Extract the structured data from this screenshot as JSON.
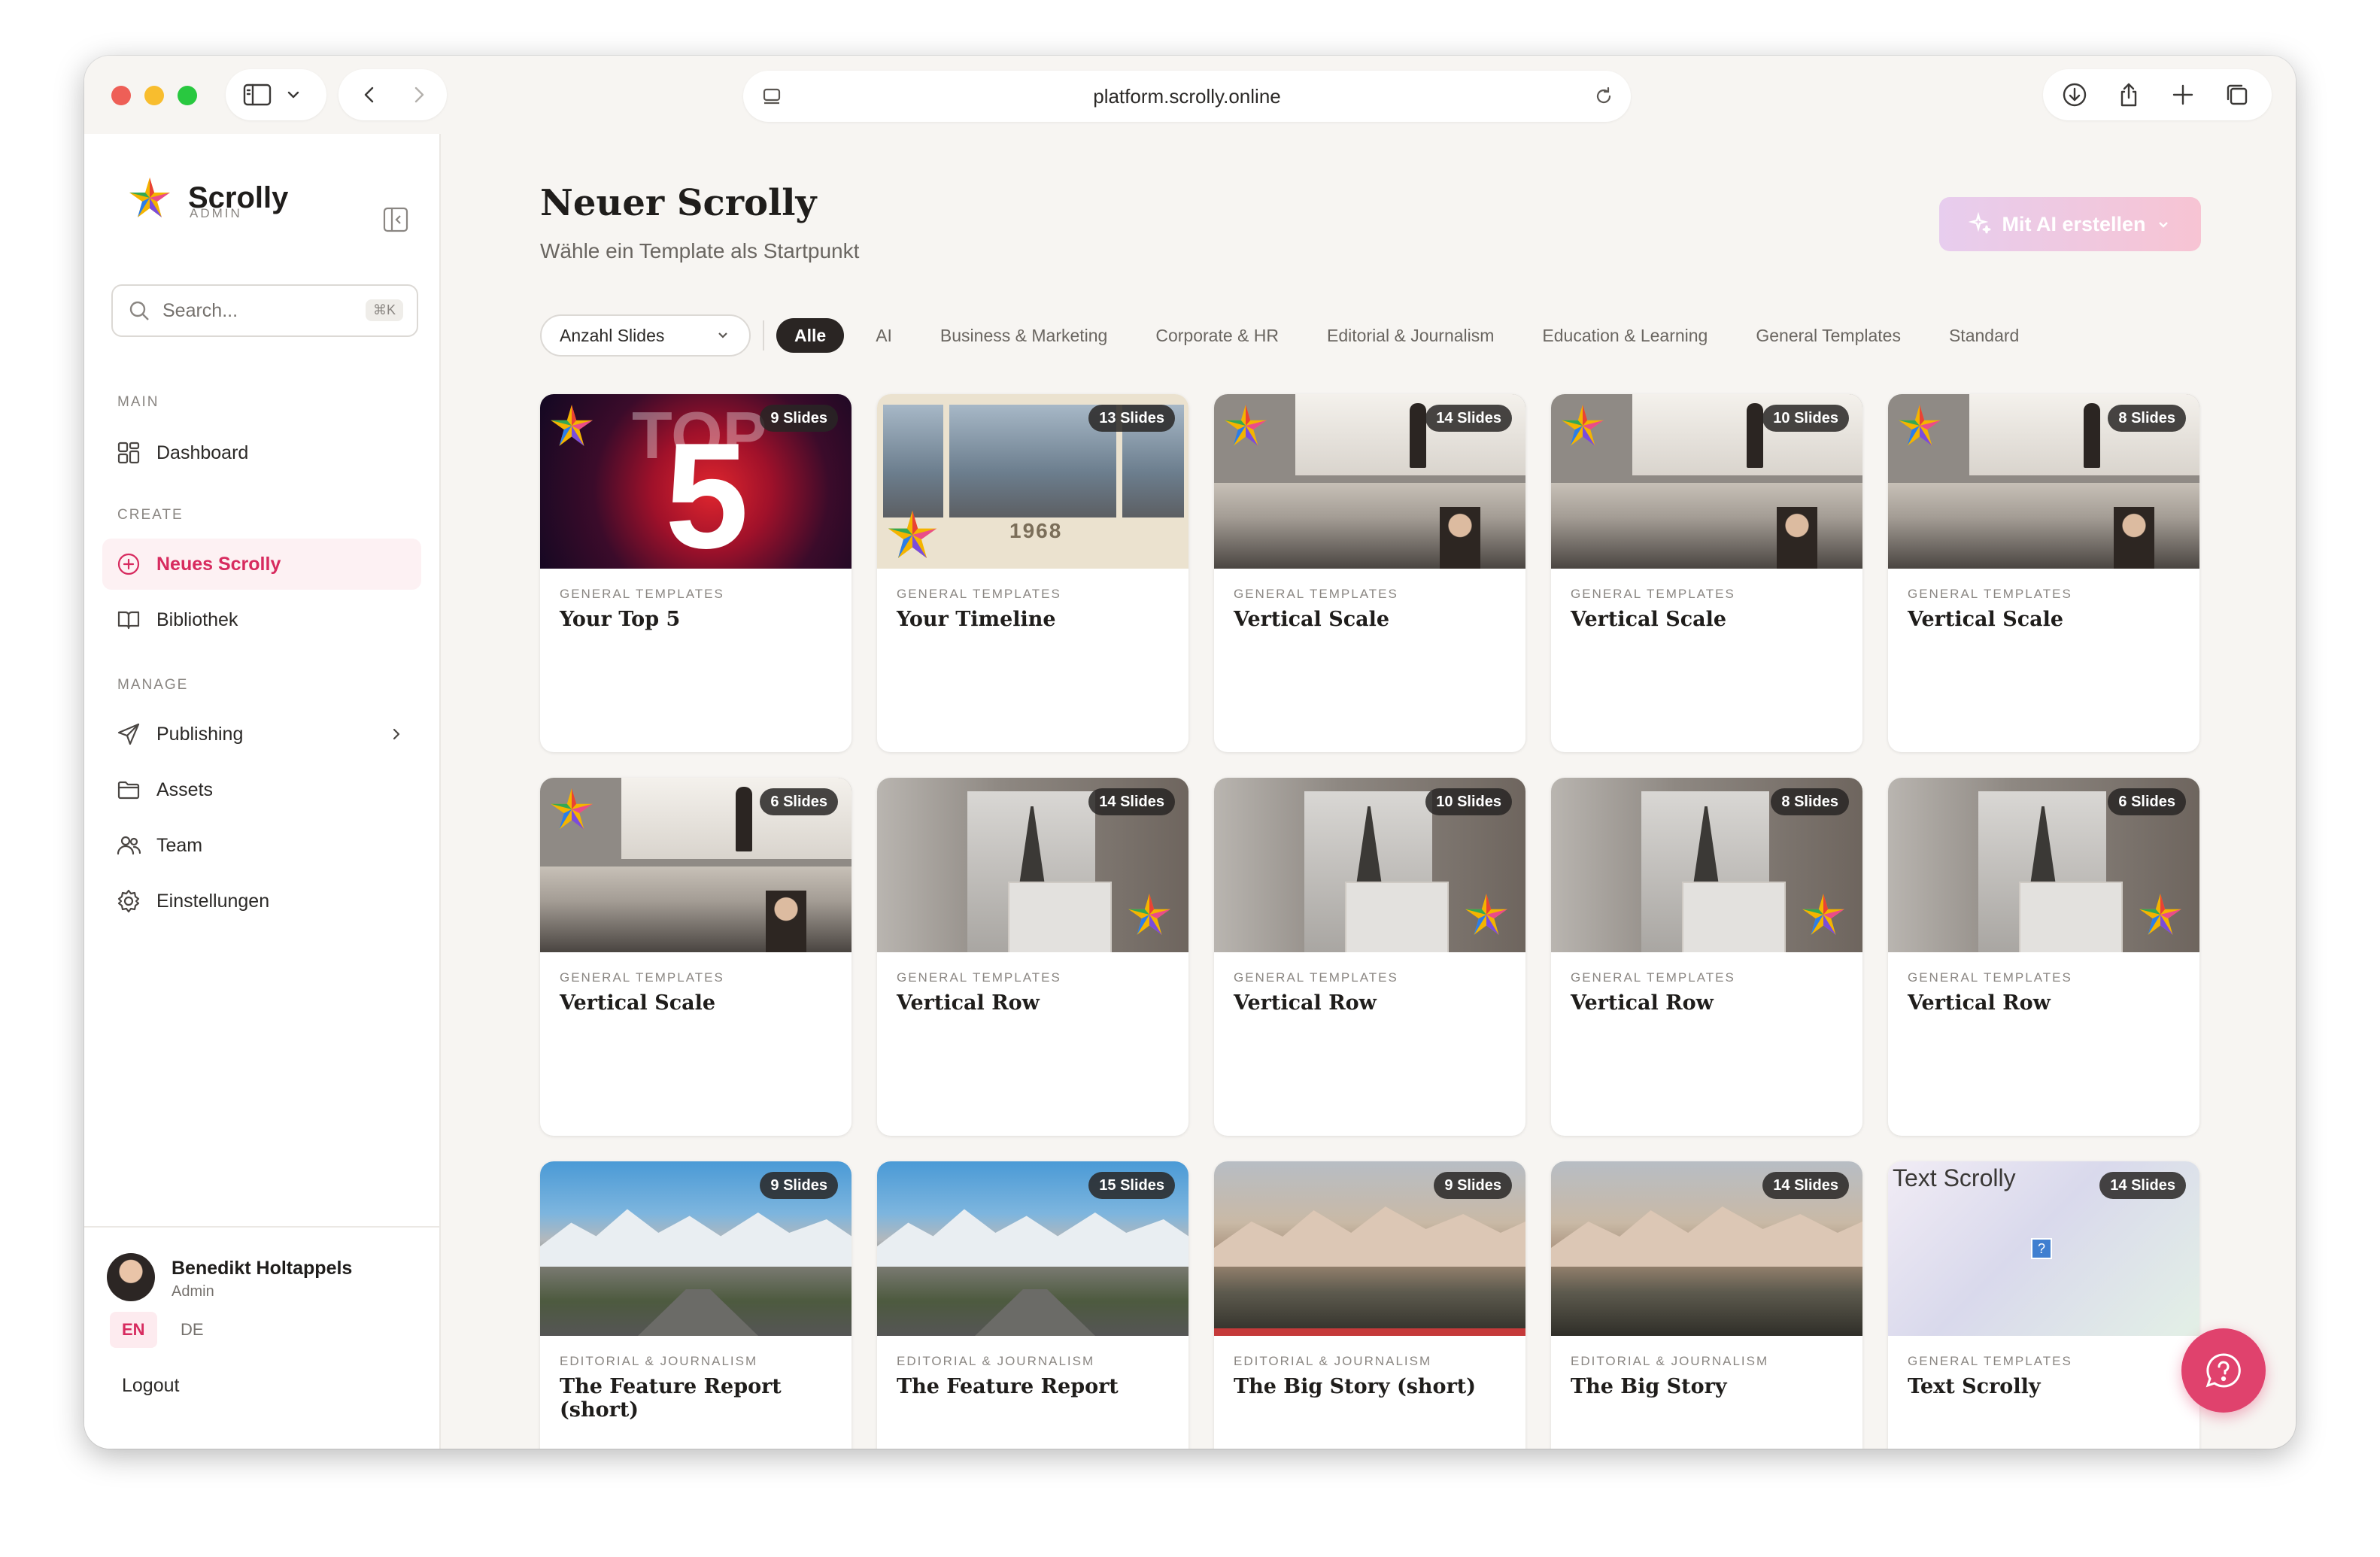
{
  "browser": {
    "url": "platform.scrolly.online"
  },
  "sidebar": {
    "brand": "Scrolly",
    "brand_sub": "ADMIN",
    "search_placeholder": "Search...",
    "search_shortcut": "⌘K",
    "sections": {
      "main": "MAIN",
      "create": "CREATE",
      "manage": "MANAGE"
    },
    "items": {
      "dashboard": "Dashboard",
      "neues_scrolly": "Neues Scrolly",
      "bibliothek": "Bibliothek",
      "publishing": "Publishing",
      "assets": "Assets",
      "team": "Team",
      "einstellungen": "Einstellungen"
    },
    "user": {
      "name": "Benedikt Holtappels",
      "role": "Admin"
    },
    "lang": {
      "en": "EN",
      "de": "DE"
    },
    "logout": "Logout"
  },
  "main": {
    "title": "Neuer Scrolly",
    "subtitle": "Wähle ein Template als Startpunkt",
    "ai_button": "Mit AI erstellen",
    "filter_select": "Anzahl Slides",
    "chips": [
      "Alle",
      "AI",
      "Business & Marketing",
      "Corporate & HR",
      "Editorial & Journalism",
      "Education & Learning",
      "General Templates",
      "Standard"
    ],
    "cards": [
      {
        "category": "GENERAL TEMPLATES",
        "title": "Your Top 5",
        "slides": "9 Slides"
      },
      {
        "category": "GENERAL TEMPLATES",
        "title": "Your Timeline",
        "slides": "13 Slides",
        "year": "1968"
      },
      {
        "category": "GENERAL TEMPLATES",
        "title": "Vertical Scale",
        "slides": "14 Slides"
      },
      {
        "category": "GENERAL TEMPLATES",
        "title": "Vertical Scale",
        "slides": "10 Slides"
      },
      {
        "category": "GENERAL TEMPLATES",
        "title": "Vertical Scale",
        "slides": "8 Slides"
      },
      {
        "category": "GENERAL TEMPLATES",
        "title": "Vertical Scale",
        "slides": "6 Slides"
      },
      {
        "category": "GENERAL TEMPLATES",
        "title": "Vertical Row",
        "slides": "14 Slides"
      },
      {
        "category": "GENERAL TEMPLATES",
        "title": "Vertical Row",
        "slides": "10 Slides"
      },
      {
        "category": "GENERAL TEMPLATES",
        "title": "Vertical Row",
        "slides": "8 Slides"
      },
      {
        "category": "GENERAL TEMPLATES",
        "title": "Vertical Row",
        "slides": "6 Slides"
      },
      {
        "category": "EDITORIAL & JOURNALISM",
        "title": "The Feature Report (short)",
        "slides": "9 Slides"
      },
      {
        "category": "EDITORIAL & JOURNALISM",
        "title": "The Feature Report",
        "slides": "15 Slides"
      },
      {
        "category": "EDITORIAL & JOURNALISM",
        "title": "The Big Story (short)",
        "slides": "9 Slides"
      },
      {
        "category": "EDITORIAL & JOURNALISM",
        "title": "The Big Story",
        "slides": "14 Slides"
      },
      {
        "category": "GENERAL TEMPLATES",
        "title": "Text Scrolly",
        "slides": "14 Slides",
        "thumb_text": "Text Scrolly"
      }
    ],
    "thumb_glyphs": {
      "top": "TOP",
      "five": "5",
      "question": "?"
    }
  },
  "colors": {
    "accent": "#d72b5f",
    "help_button": "#e0426d",
    "dark_chip": "#2a2523"
  }
}
